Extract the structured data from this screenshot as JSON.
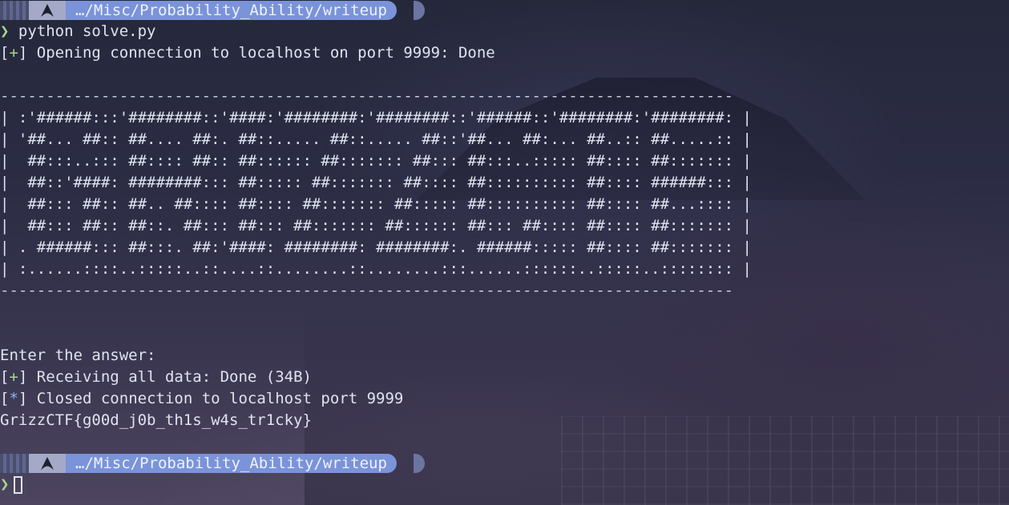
{
  "prompt": {
    "path": "…/Misc/Probability_Ability/writeup",
    "os_icon": "arch-linux-icon",
    "symbol": "❯"
  },
  "lines": {
    "command": "python solve.py",
    "status_1_tag": "+",
    "status_1_text": " Opening connection to localhost on port 9999: Done",
    "border_top": "--------------------------------------------------------------------------------",
    "banner": [
      "| :'######:::'########::'####:'########:'########::'######::'########:'########: |",
      "| '##... ##:: ##.... ##:. ##::..... ##::..... ##::'##... ##:... ##..:: ##.....:: |",
      "|  ##:::..::: ##:::: ##:: ##:::::: ##::::::: ##::: ##:::..::::: ##:::: ##::::::: |",
      "|  ##::'####: ########::: ##::::: ##::::::: ##:::: ##:::::::::: ##:::: ######::: |",
      "|  ##::: ##:: ##.. ##:::: ##:::: ##::::::: ##::::: ##:::::::::: ##:::: ##...:::: |",
      "|  ##::: ##:: ##::. ##::: ##::: ##::::::: ##:::::: ##::: ##:::: ##:::: ##::::::: |",
      "| . ######::: ##:::. ##:'####: ########: ########:. ######::::: ##:::: ##::::::: |",
      "| :......::::..:::::..::....::........::........:::......::::::..:::::..:::::::: |"
    ],
    "border_bottom": "--------------------------------------------------------------------------------",
    "enter_answer": "Enter the answer:",
    "status_2_tag": "+",
    "status_2_text": " Receiving all data: Done (34B)",
    "status_3_tag": "*",
    "status_3_text": " Closed connection to localhost port 9999",
    "flag": "GrizzCTF{g00d_j0b_th1s_w4s_tr1cky}"
  }
}
